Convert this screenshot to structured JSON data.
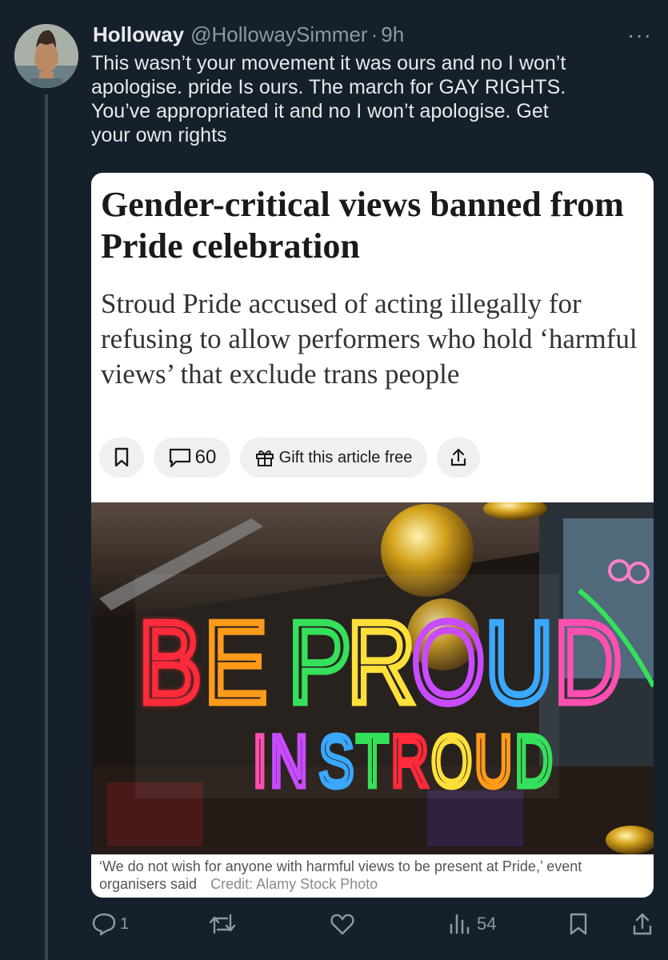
{
  "tweet": {
    "name": "Holloway",
    "handle": "@HollowaySimmer",
    "separator": "·",
    "time": "9h",
    "more": "···",
    "lines": [
      "This wasn’t your movement it was ours and no I won’t",
      "apologise. pride Is ours. The march for GAY RIGHTS.",
      "You’ve appropriated it and no I won’t apologise. Get",
      "your own rights"
    ]
  },
  "article": {
    "headline": "Gender-critical views banned from Pride celebration",
    "standfirst": "Stroud Pride accused of acting illegally for refusing to allow performers who hold ‘harmful views’ that exclude trans people",
    "comments_count": "60",
    "gift_label": "Gift this article free",
    "photo": {
      "sign_line1": "BE PROUD",
      "sign_line2": "IN STROUD",
      "sign_colors": [
        "#ff2a3a",
        "#ff9a1a",
        "#35e05a",
        "#ffe03a",
        "#c94bff",
        "#3aa8ff",
        "#ff4fb0"
      ]
    },
    "caption": "‘We do not wish for anyone with harmful views to be present at Pride,’ event organisers said",
    "credit": "Credit: Alamy Stock Photo"
  },
  "actions": {
    "replies": "1",
    "retweets": "",
    "likes": "",
    "views": "54"
  }
}
